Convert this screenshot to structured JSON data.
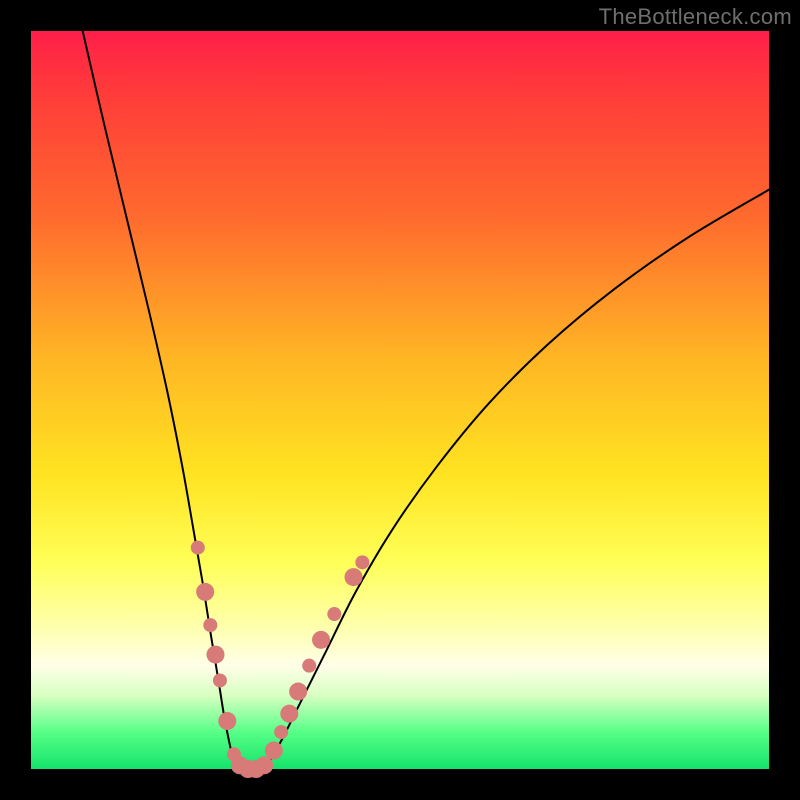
{
  "watermark": "TheBottleneck.com",
  "chart_data": {
    "type": "line",
    "title": "",
    "xlabel": "",
    "ylabel": "",
    "xlim": [
      0,
      100
    ],
    "ylim": [
      0,
      100
    ],
    "series": [
      {
        "name": "left-branch",
        "x": [
          7,
          10,
          13,
          16,
          18.5,
          20.5,
          22,
          23.3,
          24.4,
          25.4,
          26.2,
          27,
          27.6
        ],
        "y": [
          100,
          87,
          74.5,
          62,
          51,
          41,
          32.5,
          25,
          18,
          12,
          7,
          3,
          0.5
        ]
      },
      {
        "name": "floor",
        "x": [
          27.6,
          29,
          30.5,
          32
        ],
        "y": [
          0.5,
          0,
          0,
          0.5
        ]
      },
      {
        "name": "right-branch",
        "x": [
          32,
          34,
          36.5,
          40,
          44,
          49,
          55,
          62,
          70,
          79,
          89,
          100
        ],
        "y": [
          0.5,
          4,
          9,
          16,
          24,
          32.5,
          41,
          49.5,
          57.5,
          65,
          72,
          78.5
        ]
      }
    ],
    "markers": {
      "name": "highlighted-points",
      "color": "#d77a78",
      "points_xy": [
        [
          22.6,
          30
        ],
        [
          23.6,
          24
        ],
        [
          24.3,
          19.5
        ],
        [
          25.0,
          15.5
        ],
        [
          25.6,
          12
        ],
        [
          26.6,
          6.5
        ],
        [
          27.5,
          2
        ],
        [
          28.3,
          0.5
        ],
        [
          29.4,
          0
        ],
        [
          30.5,
          0
        ],
        [
          31.6,
          0.5
        ],
        [
          32.9,
          2.5
        ],
        [
          33.9,
          5
        ],
        [
          35.0,
          7.5
        ],
        [
          36.2,
          10.5
        ],
        [
          37.7,
          14
        ],
        [
          39.3,
          17.5
        ],
        [
          41.1,
          21
        ],
        [
          43.7,
          26
        ],
        [
          44.9,
          28
        ]
      ],
      "radius_pattern": [
        7,
        9,
        7,
        9,
        7,
        9,
        7,
        9,
        9,
        9,
        9,
        9,
        7,
        9,
        9,
        7,
        9,
        7,
        9,
        7
      ]
    },
    "background_gradient": {
      "top": "#ff1f4a",
      "bottom": "#14e36b"
    }
  }
}
